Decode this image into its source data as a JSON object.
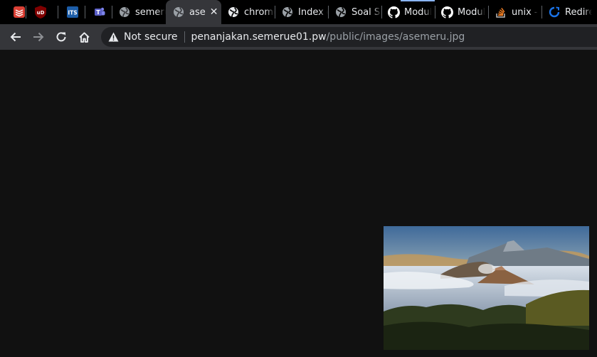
{
  "tabs": [
    {
      "title": "",
      "icon": "todoist-icon",
      "color": "#db4035"
    },
    {
      "title": "",
      "icon": "ublock-icon",
      "color": "#800000"
    },
    {
      "title": "",
      "icon": "its-icon",
      "color": "#1c5da8"
    },
    {
      "title": "",
      "icon": "teams-icon",
      "color": "#5b5fc7"
    },
    {
      "title": "semeru",
      "icon": "globe-icon"
    },
    {
      "title": "ase",
      "icon": "globe-icon",
      "active": true
    },
    {
      "title": "chrome",
      "icon": "globe-icon"
    },
    {
      "title": "Index o",
      "icon": "globe-icon"
    },
    {
      "title": "Soal Sh",
      "icon": "globe-icon"
    },
    {
      "title": "Modul",
      "icon": "github-icon"
    },
    {
      "title": "Modul",
      "icon": "github-icon"
    },
    {
      "title": "unix - ",
      "icon": "stackoverflow-icon",
      "color": "#f48024"
    },
    {
      "title": "Redirec",
      "icon": "redirect-icon",
      "color": "#1a73e8"
    }
  ],
  "toolbar": {
    "security_label": "Not secure",
    "url_host": "penanjakan.semerue01.pw",
    "url_path": "/public/images/asemeru.jpg"
  },
  "content": {
    "image_alt": "",
    "background": "#111111"
  }
}
